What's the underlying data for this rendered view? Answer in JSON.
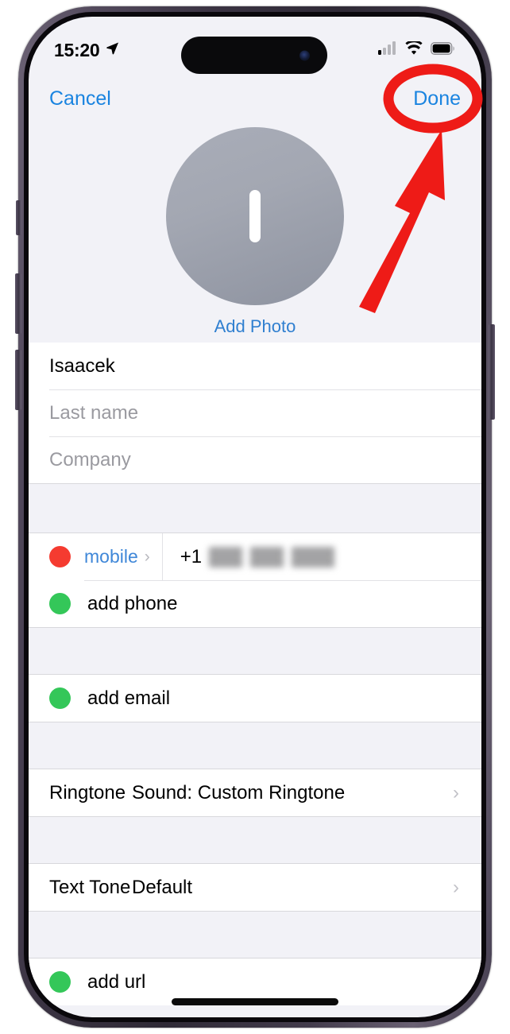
{
  "status_bar": {
    "time": "15:20",
    "location_icon": "location-arrow-icon",
    "cellular_icon": "cellular-signal-icon",
    "wifi_icon": "wifi-icon",
    "battery_icon": "battery-icon"
  },
  "nav_bar": {
    "cancel_label": "Cancel",
    "done_label": "Done"
  },
  "photo_header": {
    "avatar_initial": "I",
    "add_photo_label": "Add Photo"
  },
  "name_fields": {
    "first_name_value": "Isaacek",
    "last_name_placeholder": "Last name",
    "company_placeholder": "Company"
  },
  "phone_section": {
    "remove_icon": "minus-circle-icon",
    "label": "mobile",
    "disclosure_icon": "chevron-right-icon",
    "country_code": "+1",
    "number_redacted": "",
    "add_icon": "plus-circle-icon",
    "add_label": "add phone"
  },
  "email_section": {
    "add_icon": "plus-circle-icon",
    "add_label": "add email"
  },
  "tones": [
    {
      "label": "Ringtone",
      "value": "Sound: Custom Ringtone",
      "disclosure_icon": "chevron-right-icon"
    },
    {
      "label": "Text Tone",
      "value": "Default",
      "disclosure_icon": "chevron-right-icon"
    }
  ],
  "url_section": {
    "add_icon": "plus-circle-icon",
    "add_label": "add url"
  },
  "annotation": {
    "highlight_color": "#ee1b17",
    "ellipse_target": "done-button",
    "arrow_icon": "arrow-pointing-up-right-icon"
  },
  "colors": {
    "accent_blue": "#1a84e0",
    "group_background": "#f2f2f7",
    "row_background": "#ffffff",
    "green": "#34c759",
    "red": "#f53b30"
  }
}
